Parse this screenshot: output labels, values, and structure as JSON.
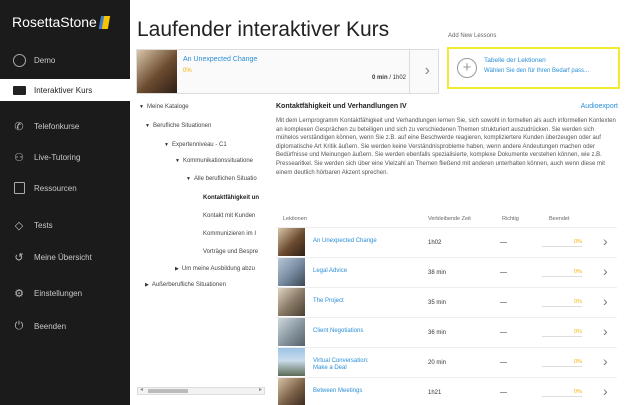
{
  "app": {
    "brand": "Rosetta Stone",
    "brand_prefix": "Rosetta",
    "brand_suffix": "Stone"
  },
  "sidebar": {
    "items": [
      {
        "label": "Demo",
        "icon": "user-circle-icon",
        "active": false
      },
      {
        "label": "Interaktiver Kurs",
        "icon": "screen-icon",
        "active": true
      },
      {
        "label": "Telefonkurse",
        "icon": "phone-icon",
        "active": false
      },
      {
        "label": "Live-Tutoring",
        "icon": "people-icon",
        "active": false
      },
      {
        "label": "Ressourcen",
        "icon": "document-icon",
        "active": false
      },
      {
        "label": "Tests",
        "icon": "graduation-cap-icon",
        "active": false
      },
      {
        "label": "Meine Übersicht",
        "icon": "history-icon",
        "active": false
      },
      {
        "label": "Einstellungen",
        "icon": "gear-icon",
        "active": false
      },
      {
        "label": "Beenden",
        "icon": "power-icon",
        "active": false
      }
    ]
  },
  "header": {
    "title": "Laufender interaktiver Kurs",
    "add_lessons": "Add New Lessons"
  },
  "current_course": {
    "name": "An Unexpected Change",
    "percent": "0%",
    "time_bold": "0 min",
    "time_rest": "/ 1h02"
  },
  "lesson_table": {
    "title": "Tabelle der Lektionen",
    "subtitle": "Wählen Sie den für Ihren Bedarf pass..."
  },
  "tree": [
    {
      "label": "Meine Kataloge",
      "tri": "▼"
    },
    {
      "label": "Berufliche Situationen",
      "tri": "▼"
    },
    {
      "label": "Expertenniveau - C1",
      "tri": "▼"
    },
    {
      "label": "Kommunikationssituatione",
      "tri": "▼"
    },
    {
      "label": "Alle beruflichen Situatio",
      "tri": "▼"
    },
    {
      "label": "Kontaktfähigkeit un",
      "tri": ""
    },
    {
      "label": "Kontakt mit Kunden",
      "tri": ""
    },
    {
      "label": "Kommunizieren im I",
      "tri": ""
    },
    {
      "label": "Vorträge und Bespre",
      "tri": ""
    },
    {
      "label": "Um meine Ausbildung abzu",
      "tri": "▶"
    },
    {
      "label": "Außerberufliche Situationen",
      "tri": "▶"
    }
  ],
  "details": {
    "title": "Kontaktfähigkeit und Verhandlungen IV",
    "audio_export": "Audioexport",
    "description": "Mit dem Lernprogramm Kontaktfähigkeit und Verhandlungen lernen Sie, sich sowohl in formellen als auch informellen Kontexten an komplexen Gesprächen zu beteiligen und sich zu verschiedenen Themen strukturiert auszudrücken. Sie werden sich mühelos verständigen können, wenn Sie z.B. auf eine Beschwerde reagieren, kompliziertere Kunden überzeugen oder auf diplomatische Art Kritik äußern. Sie werden keine Verständnisprobleme haben, wenn andere Andeutungen machen oder Bedürfnisse und Meinungen äußern. Sie werden ebenfalls spezialisierte, komplexe Dokumente verstehen können, wie z.B. Pressearitkel. Sie werden sich über eine Vielzahl an Themen fließend mit anderen unterhalten können, auch wenn diese mit einem deutlich hörbaren Akzent sprechen."
  },
  "table": {
    "headers": [
      "Lektionen",
      "Verbleibende Zeit",
      "Richtig",
      "Beendet"
    ],
    "rows": [
      {
        "name": "An Unexpected Change",
        "time": "1h02",
        "correct": "—",
        "done": "0%"
      },
      {
        "name": "Legal Advice",
        "time": "38 min",
        "correct": "—",
        "done": "0%"
      },
      {
        "name": "The Project",
        "time": "35 min",
        "correct": "—",
        "done": "0%"
      },
      {
        "name": "Client Negotiations",
        "time": "36 min",
        "correct": "—",
        "done": "0%"
      },
      {
        "name": "Virtual Conversation: Make a Deal",
        "time": "20 min",
        "correct": "—",
        "done": "0%"
      },
      {
        "name": "Between Meetings",
        "time": "1h21",
        "correct": "—",
        "done": "0%"
      }
    ]
  },
  "colors": {
    "accent": "#2b8fd8",
    "progress": "#f0b400",
    "highlight": "#f3ea30",
    "sidebar": "#1b1b1b"
  }
}
